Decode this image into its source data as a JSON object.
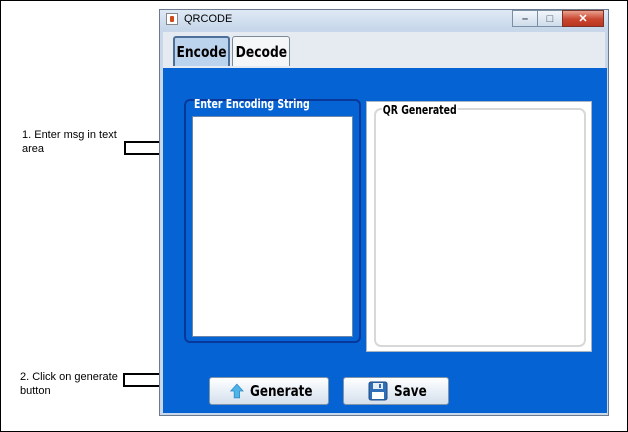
{
  "annotations": {
    "step1": "1. Enter msg in text area",
    "step2": "2. Click on generate button"
  },
  "window": {
    "title": "QRCODE",
    "controls": [
      "minimize",
      "maximize",
      "close"
    ]
  },
  "tabs": [
    {
      "label": "Encode",
      "active": true
    },
    {
      "label": "Decode",
      "active": false
    }
  ],
  "encode": {
    "input_group_title": "Enter Encoding String",
    "input_value": "",
    "output_group_title": "QR Generated"
  },
  "buttons": {
    "generate": {
      "label": "Generate",
      "icon": "up-arrow-icon"
    },
    "save": {
      "label": "Save",
      "icon": "floppy-disk-icon"
    }
  },
  "colors": {
    "panel_background": "#0563d3",
    "group_border": "#08389a",
    "arrow_icon": "#4fb3e8"
  }
}
